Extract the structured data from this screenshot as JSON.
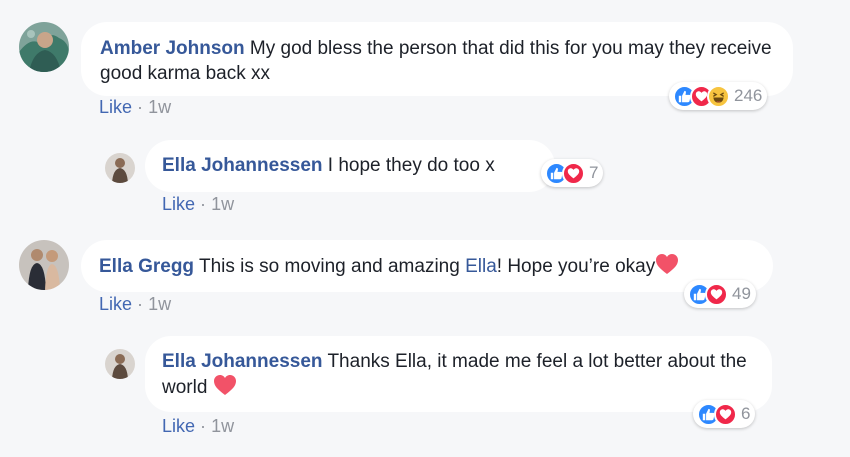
{
  "comments": [
    {
      "author": "Amber Johnson",
      "text": "My god bless the person that did this for you may they receive good karma back xx",
      "like_label": "Like",
      "time": "1w",
      "reaction_count": "246"
    },
    {
      "author": "Ella Johannessen",
      "text": "I hope they do too x",
      "like_label": "Like",
      "time": "1w",
      "reaction_count": "7"
    },
    {
      "author": "Ella Gregg",
      "text_before": "This is so moving and amazing",
      "mention": "Ella",
      "text_after": "! Hope you’re okay",
      "like_label": "Like",
      "time": "1w",
      "reaction_count": "49"
    },
    {
      "author": "Ella Johannessen",
      "text": "Thanks Ella, it made me feel a lot better about the world",
      "like_label": "Like",
      "time": "1w",
      "reaction_count": "6"
    }
  ],
  "separator": "·",
  "icons": {
    "like": "like-reaction-icon",
    "love": "love-reaction-icon",
    "haha": "haha-reaction-icon",
    "inline_heart": "heart-emoji-icon"
  },
  "colors": {
    "background": "#f6f7f9",
    "author": "#365899",
    "like_link": "#4267b2",
    "meta": "#90949c",
    "like_reaction": "#2d88ff",
    "love_reaction": "#f0284a",
    "haha_reaction": "#f7c43f"
  }
}
